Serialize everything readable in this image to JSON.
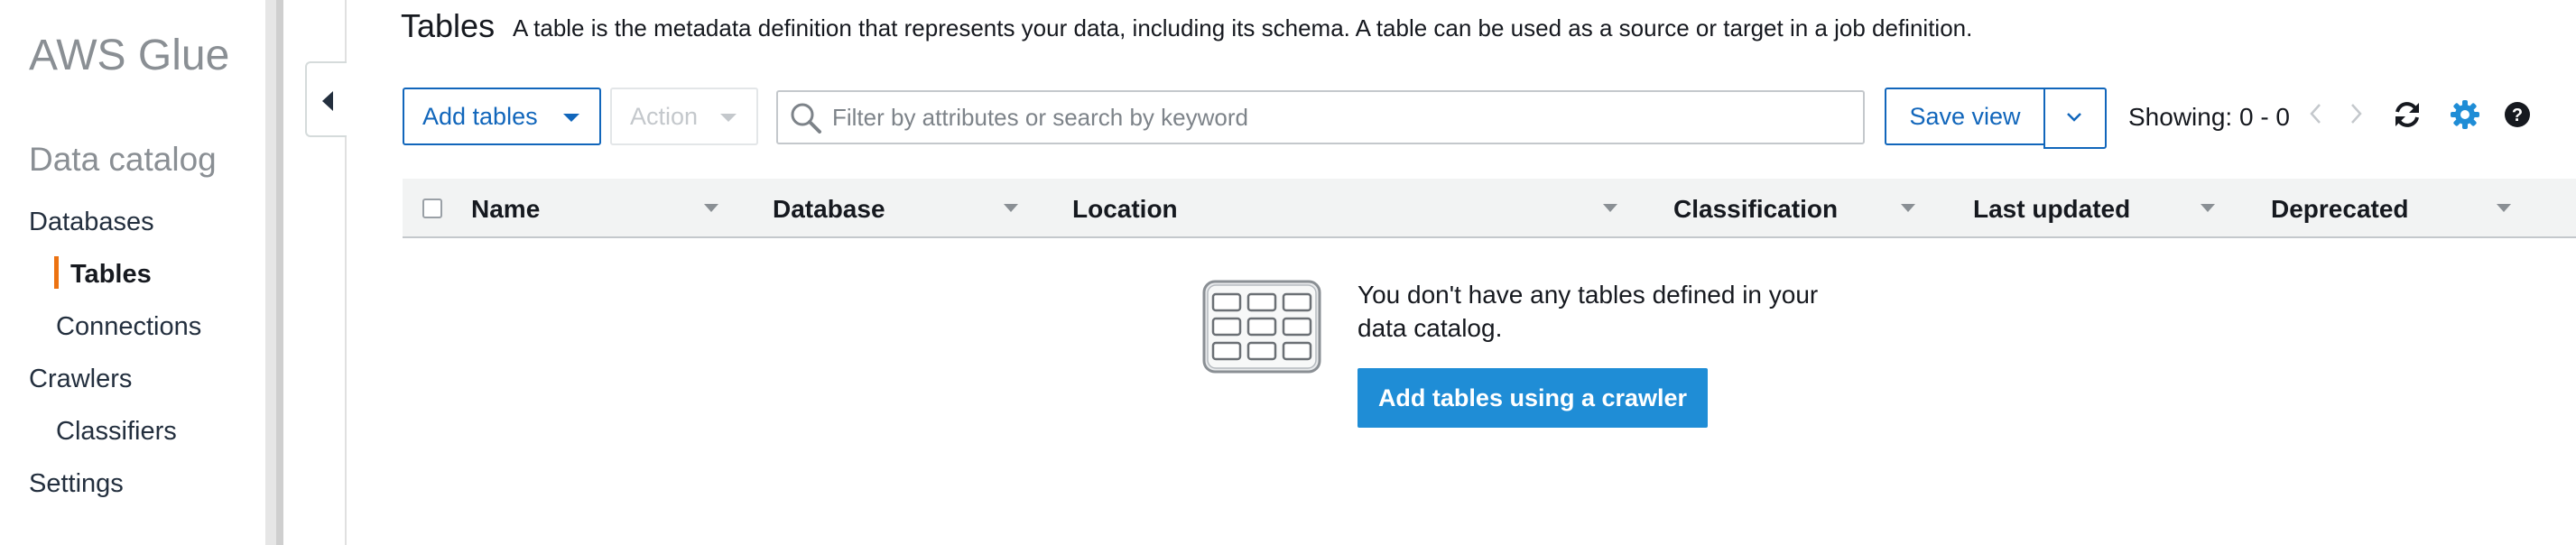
{
  "sidebar": {
    "brand": "AWS Glue",
    "section": "Data catalog",
    "items": {
      "databases": "Databases",
      "tables": "Tables",
      "connections": "Connections",
      "crawlers": "Crawlers",
      "classifiers": "Classifiers",
      "settings": "Settings"
    },
    "accent_color": "#ec7211"
  },
  "header": {
    "title": "Tables",
    "description": "A table is the metadata definition that represents your data, including its schema. A table can be used as a source or target in a job definition."
  },
  "toolbar": {
    "add_tables_label": "Add tables",
    "action_label": "Action",
    "search_placeholder": "Filter by attributes or search by keyword",
    "save_view_label": "Save view",
    "showing": "Showing: 0 - 0",
    "icons": [
      "chevron-left-icon",
      "chevron-right-icon",
      "refresh-icon",
      "gear-icon",
      "help-icon"
    ],
    "primary_color": "#1166bb"
  },
  "table": {
    "columns": [
      "Name",
      "Database",
      "Location",
      "Classification",
      "Last updated",
      "Deprecated"
    ],
    "rows": []
  },
  "empty_state": {
    "message": "You don't have any tables defined in your data catalog.",
    "button_label": "Add tables using a crawler",
    "icon": "table-grid-icon"
  }
}
